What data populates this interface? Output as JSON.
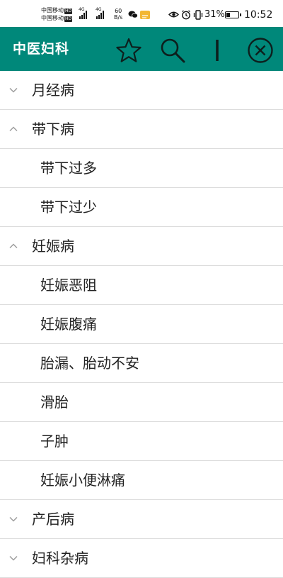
{
  "status_bar": {
    "carrier_1": "中国移动",
    "carrier_2": "中国移动",
    "hd_badge": "HD",
    "signal_tag": "4G",
    "net_speed_value": "60",
    "net_speed_unit": "B/s",
    "battery_percent": "31%",
    "battery_level": 0.31,
    "time": "10:52",
    "icons": [
      "wechat-icon",
      "message-icon",
      "eye-icon",
      "alarm-icon",
      "vibrate-icon",
      "battery-icon"
    ]
  },
  "app_bar": {
    "title": "中医妇科",
    "actions": [
      "star-icon",
      "search-icon",
      "text-cursor-icon",
      "close-circle-icon"
    ],
    "background": "#00887a",
    "foreground": "#ffffff"
  },
  "tree": {
    "categories": [
      {
        "label": "月经病",
        "expanded": false,
        "items": []
      },
      {
        "label": "带下病",
        "expanded": true,
        "items": [
          "带下过多",
          "带下过少"
        ]
      },
      {
        "label": "妊娠病",
        "expanded": true,
        "items": [
          "妊娠恶阻",
          "妊娠腹痛",
          "胎漏、胎动不安",
          "滑胎",
          "子肿",
          "妊娠小便淋痛"
        ]
      },
      {
        "label": "产后病",
        "expanded": false,
        "items": []
      },
      {
        "label": "妇科杂病",
        "expanded": false,
        "items": []
      }
    ]
  }
}
